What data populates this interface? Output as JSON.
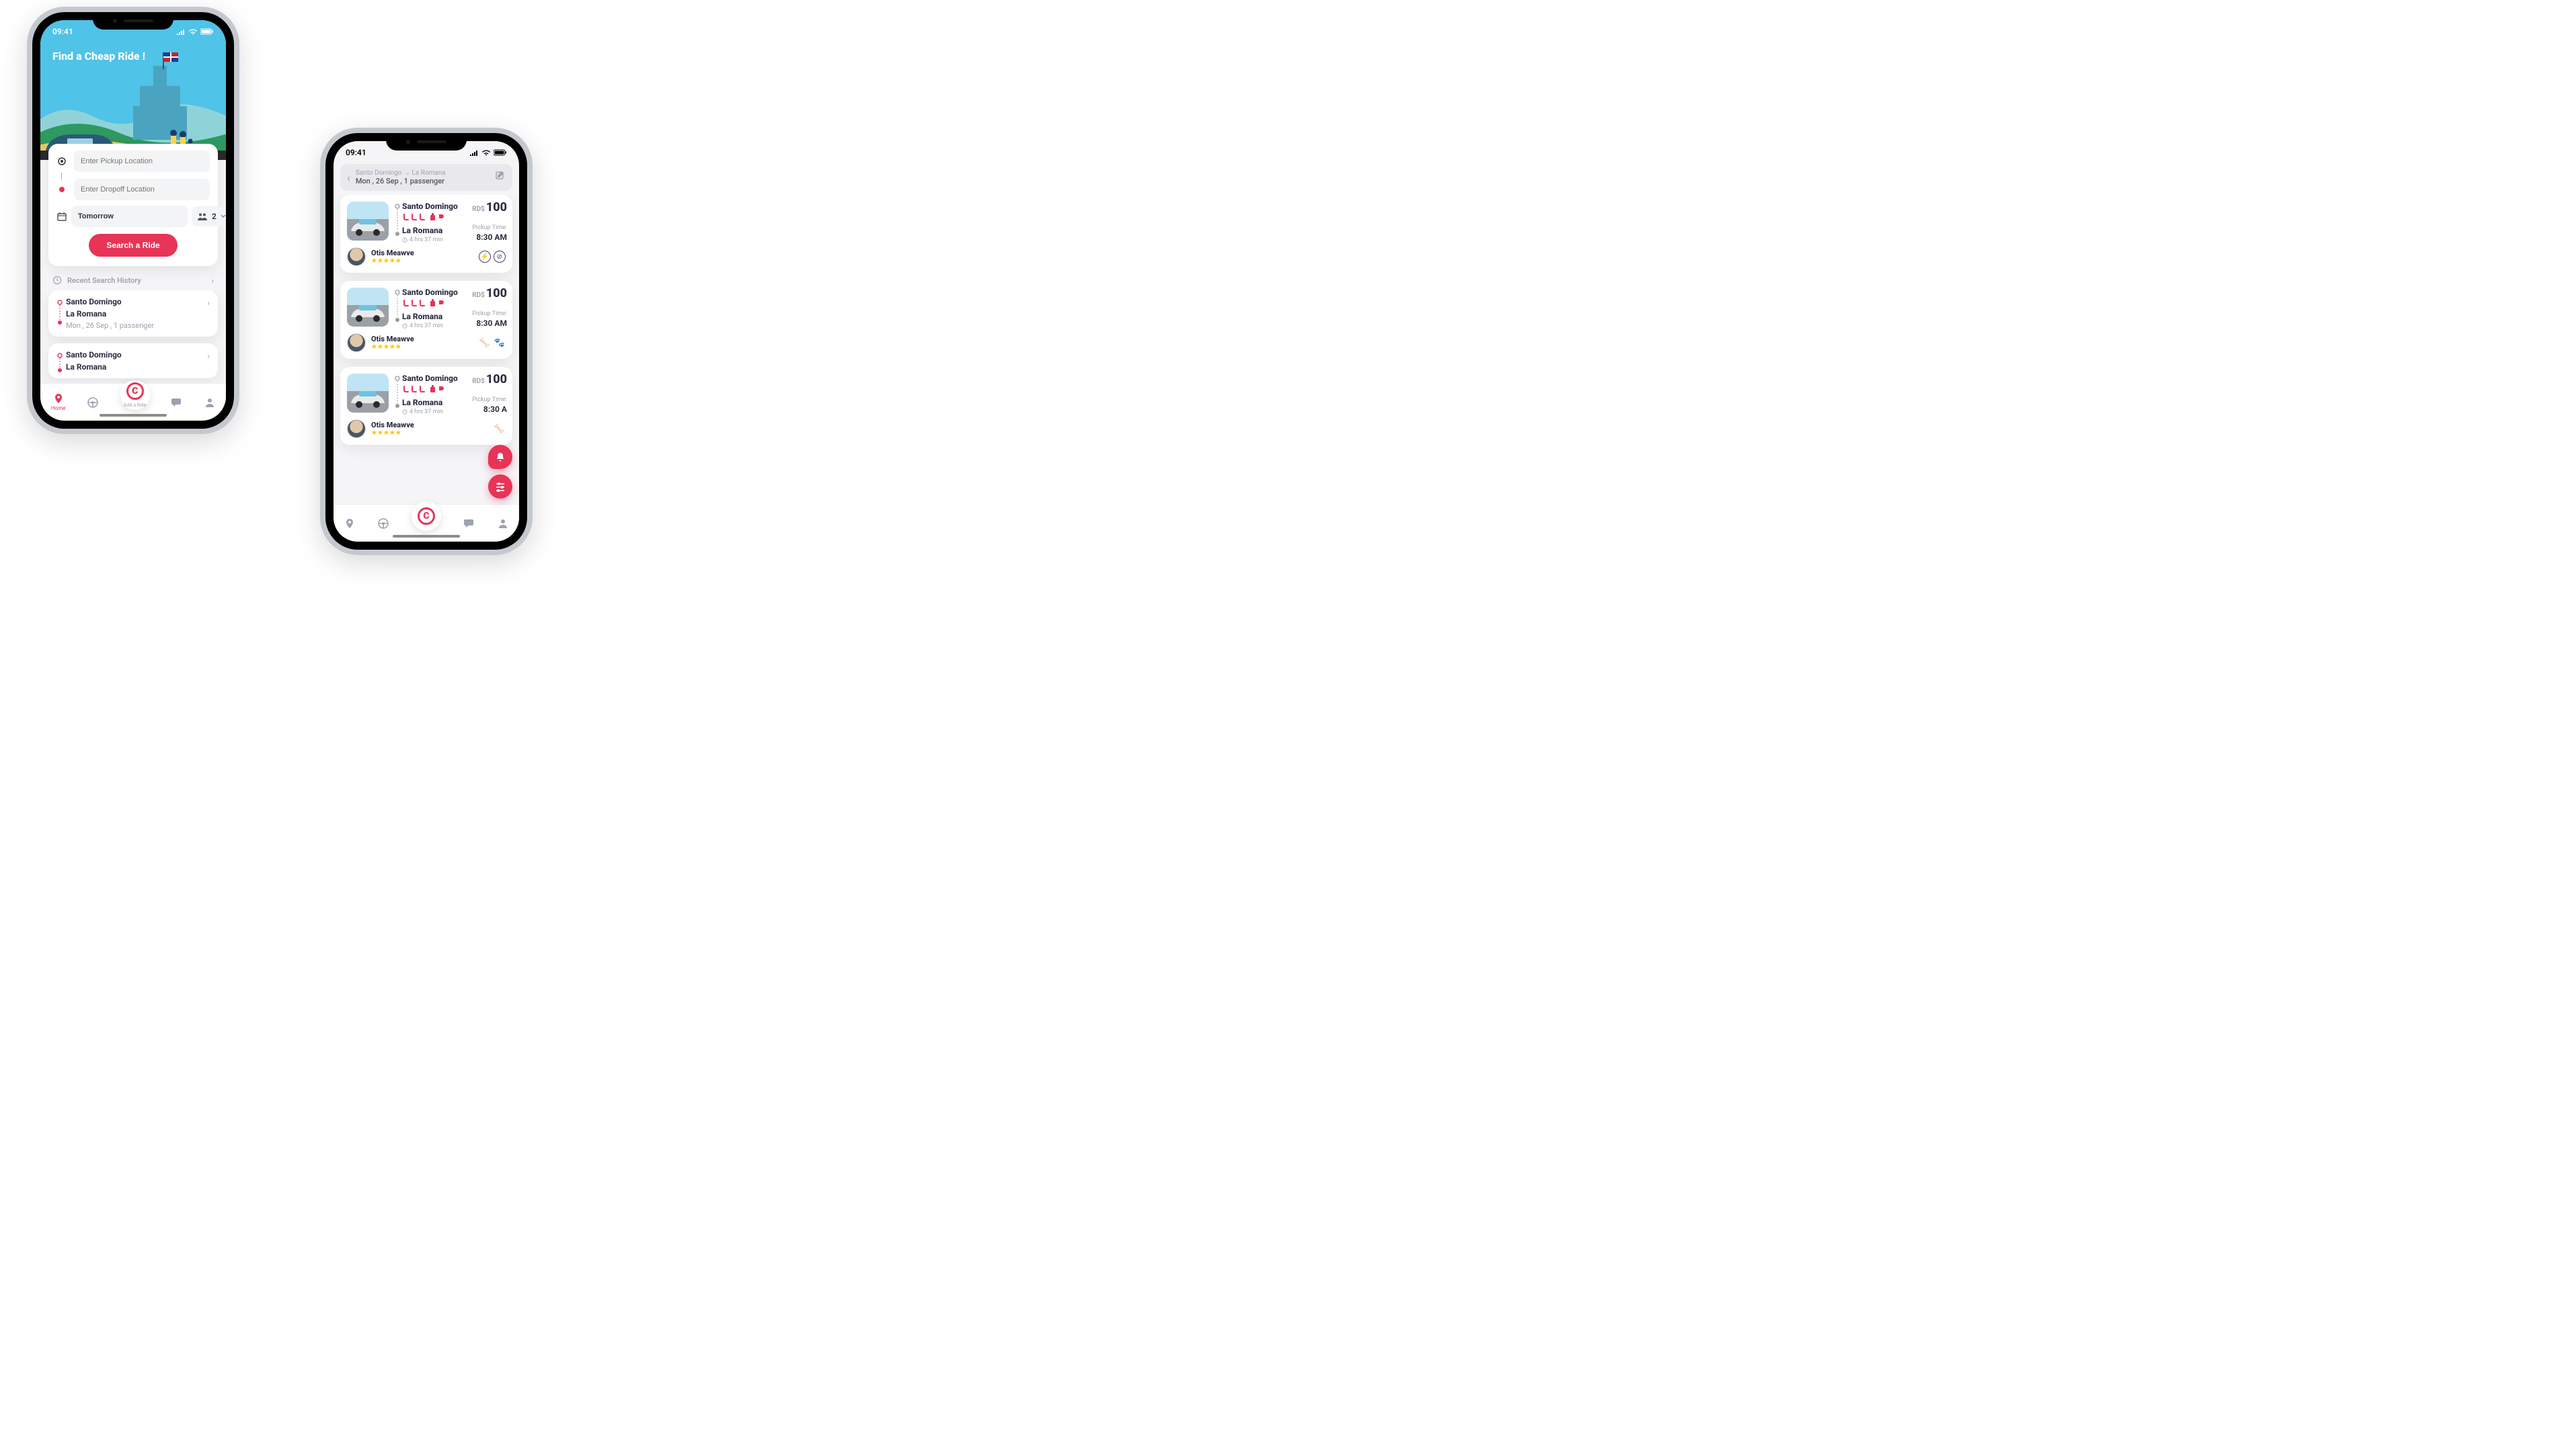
{
  "colors": {
    "accent": "#e73457"
  },
  "status": {
    "time": "09:41"
  },
  "home": {
    "hero_title": "Find a Cheap Ride !",
    "pickup_placeholder": "Enter Pickup Location",
    "dropoff_placeholder": "Enter Dropoff Location",
    "date_value": "Tomorrow",
    "passengers": "2",
    "search_button": "Search a Ride",
    "recent_label": "Recent Search History",
    "history": [
      {
        "origin": "Santo Domingo",
        "dest": "La Romana",
        "meta": "Mon , 26 Sep , 1 passenger"
      },
      {
        "origin": "Santo Domingo",
        "dest": "La Romana"
      }
    ],
    "tab_home": "Home",
    "tab_add": "Add a Ride"
  },
  "results": {
    "route_from": "Santo Domingo",
    "route_to": "La Romana",
    "subtitle": "Mon , 26 Sep , 1 passenger",
    "currency": "RD$",
    "rides": [
      {
        "origin": "Santo Domingo",
        "dest": "La Romana",
        "duration": "4 hrs 37 min",
        "price": "100",
        "pickup_label": "Pickup Time:",
        "pickup_time": "8:30 AM",
        "driver": "Otis Meawve"
      },
      {
        "origin": "Santo Domingo",
        "dest": "La Romana",
        "duration": "4 hrs 37 min",
        "price": "100",
        "pickup_label": "Pickup Time:",
        "pickup_time": "8:30 AM",
        "driver": "Otis Meawve"
      },
      {
        "origin": "Santo Domingo",
        "dest": "La Romana",
        "duration": "4 hrs 37 min",
        "price": "100",
        "pickup_label": "Pickup Time:",
        "pickup_time": "8:30 A",
        "driver": "Otis Meawve"
      }
    ]
  }
}
